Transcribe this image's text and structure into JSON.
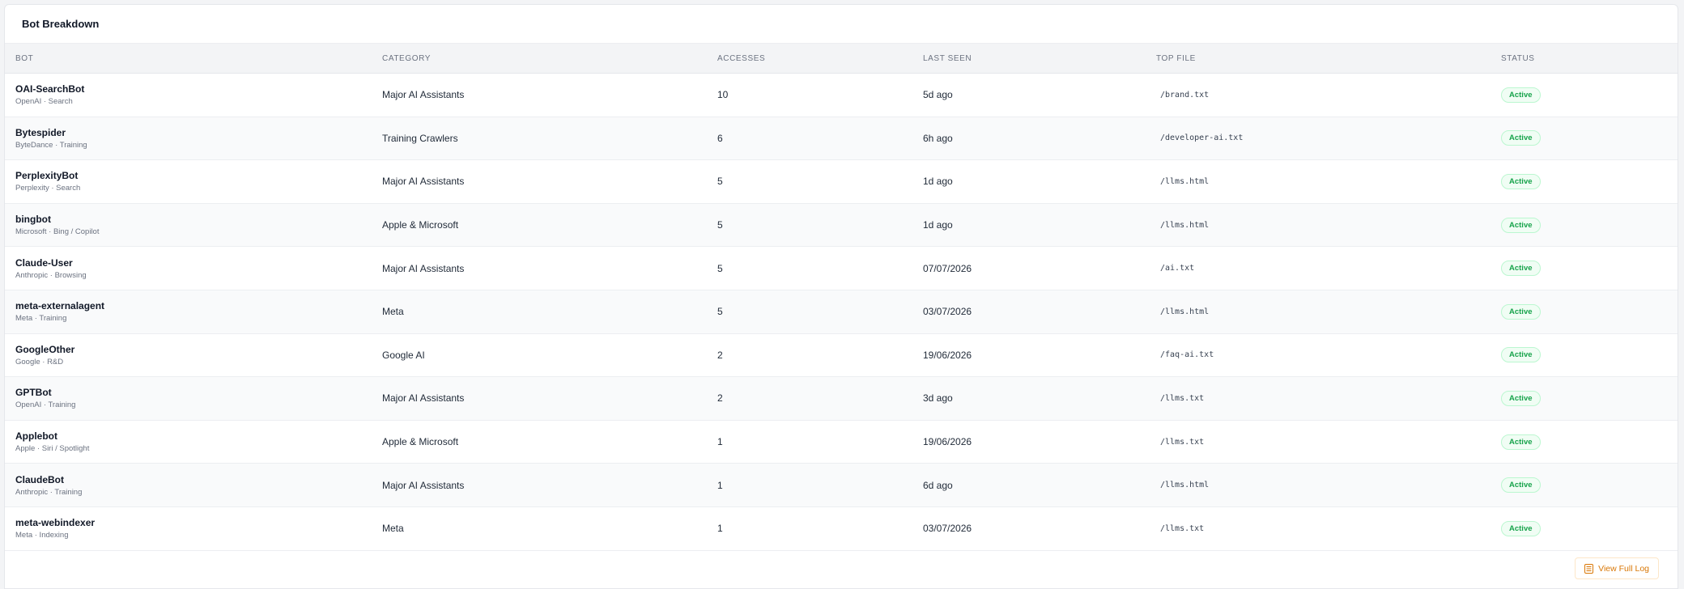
{
  "card": {
    "title": "Bot Breakdown"
  },
  "columns": {
    "bot": "BOT",
    "category": "CATEGORY",
    "accesses": "ACCESSES",
    "last_seen": "LAST SEEN",
    "top_file": "TOP FILE",
    "status": "STATUS"
  },
  "rows": [
    {
      "name": "OAI-SearchBot",
      "sub": "OpenAI · Search",
      "category": "Major AI Assistants",
      "accesses": "10",
      "last_seen": "5d ago",
      "top_file": "/brand.txt",
      "status": "Active"
    },
    {
      "name": "Bytespider",
      "sub": "ByteDance · Training",
      "category": "Training Crawlers",
      "accesses": "6",
      "last_seen": "6h ago",
      "top_file": "/developer-ai.txt",
      "status": "Active"
    },
    {
      "name": "PerplexityBot",
      "sub": "Perplexity · Search",
      "category": "Major AI Assistants",
      "accesses": "5",
      "last_seen": "1d ago",
      "top_file": "/llms.html",
      "status": "Active"
    },
    {
      "name": "bingbot",
      "sub": "Microsoft · Bing / Copilot",
      "category": "Apple & Microsoft",
      "accesses": "5",
      "last_seen": "1d ago",
      "top_file": "/llms.html",
      "status": "Active"
    },
    {
      "name": "Claude-User",
      "sub": "Anthropic · Browsing",
      "category": "Major AI Assistants",
      "accesses": "5",
      "last_seen": "07/07/2026",
      "top_file": "/ai.txt",
      "status": "Active"
    },
    {
      "name": "meta-externalagent",
      "sub": "Meta · Training",
      "category": "Meta",
      "accesses": "5",
      "last_seen": "03/07/2026",
      "top_file": "/llms.html",
      "status": "Active"
    },
    {
      "name": "GoogleOther",
      "sub": "Google · R&D",
      "category": "Google AI",
      "accesses": "2",
      "last_seen": "19/06/2026",
      "top_file": "/faq-ai.txt",
      "status": "Active"
    },
    {
      "name": "GPTBot",
      "sub": "OpenAI · Training",
      "category": "Major AI Assistants",
      "accesses": "2",
      "last_seen": "3d ago",
      "top_file": "/llms.txt",
      "status": "Active"
    },
    {
      "name": "Applebot",
      "sub": "Apple · Siri / Spotlight",
      "category": "Apple & Microsoft",
      "accesses": "1",
      "last_seen": "19/06/2026",
      "top_file": "/llms.txt",
      "status": "Active"
    },
    {
      "name": "ClaudeBot",
      "sub": "Anthropic · Training",
      "category": "Major AI Assistants",
      "accesses": "1",
      "last_seen": "6d ago",
      "top_file": "/llms.html",
      "status": "Active"
    },
    {
      "name": "meta-webindexer",
      "sub": "Meta · Indexing",
      "category": "Meta",
      "accesses": "1",
      "last_seen": "03/07/2026",
      "top_file": "/llms.txt",
      "status": "Active"
    }
  ],
  "footer": {
    "view_full_log_label": "View Full Log",
    "icon": "log-list-icon"
  },
  "colors": {
    "status_active_text": "#16a34a",
    "status_active_bg": "#f0fdf4",
    "accent": "#d97706"
  }
}
